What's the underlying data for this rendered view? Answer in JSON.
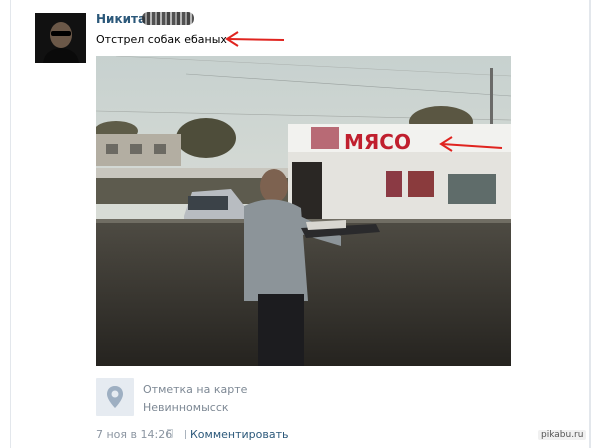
{
  "post": {
    "author_name": "Никита",
    "text": "Отстрел собак ебаных",
    "sign_text": "МЯСО",
    "location_label": "Отметка на карте",
    "location_city": "Невинномысск",
    "date": "7 ноя в 14:26",
    "comment_label": "Комментировать"
  },
  "watermark": "pikabu.ru",
  "colors": {
    "link": "#2b587a",
    "muted": "#7d8894",
    "arrow": "#e0241f"
  },
  "icons": {
    "location": "map-pin-icon",
    "platform": "apple-icon"
  }
}
